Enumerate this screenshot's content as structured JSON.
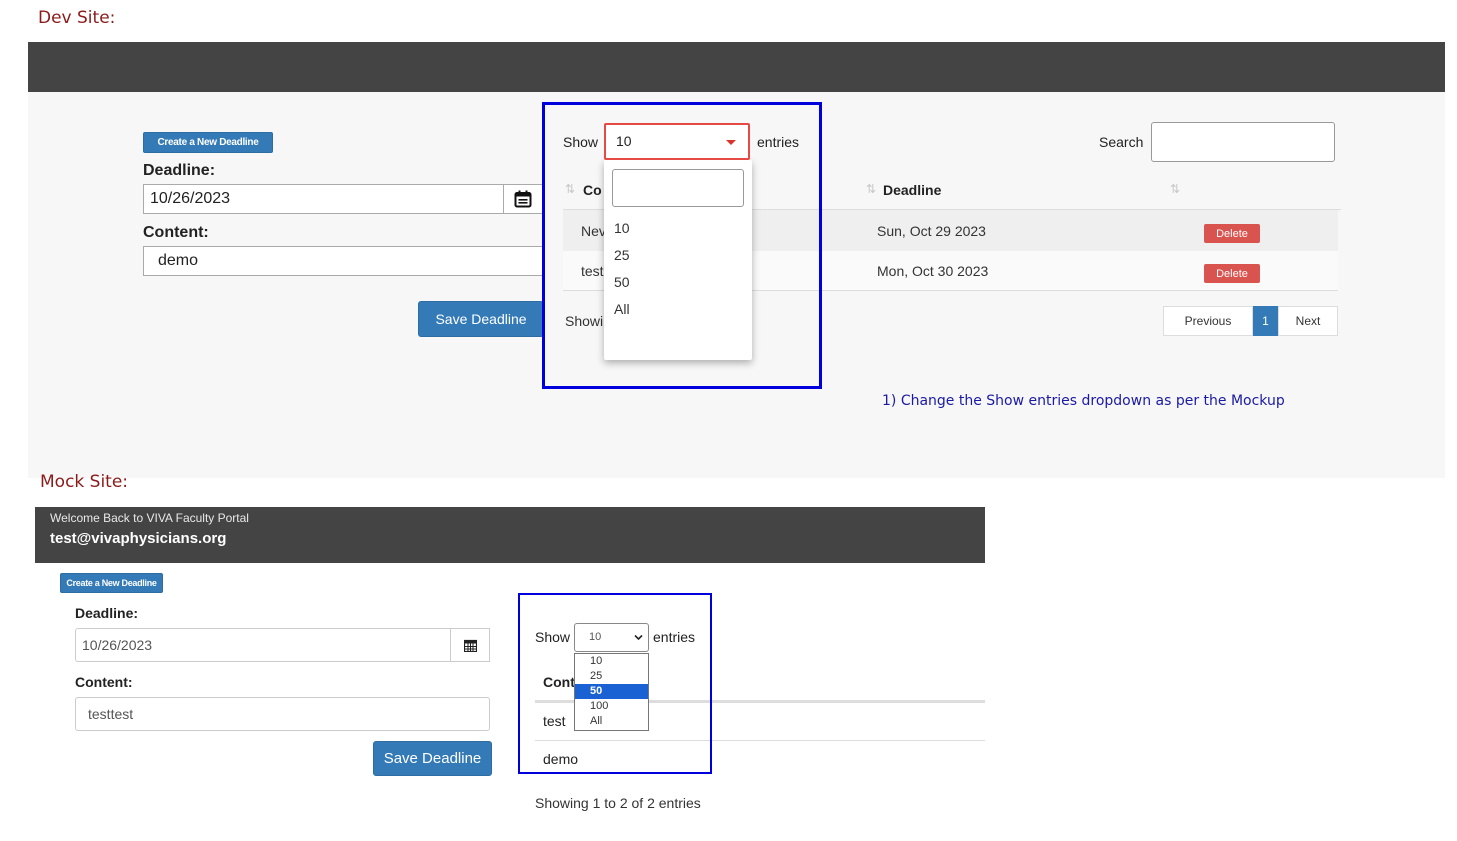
{
  "dev": {
    "section_title": "Dev Site:",
    "create_button": "Create a New Deadline",
    "deadline_label": "Deadline:",
    "deadline_value": "10/26/2023",
    "content_label": "Content:",
    "content_value": "demo",
    "save_button": "Save Deadline",
    "show_label": "Show",
    "show_selected": "10",
    "entries_label": "entries",
    "search_label": "Search",
    "search_value": "",
    "dropdown_options": [
      "10",
      "25",
      "50",
      "All"
    ],
    "columns": [
      "Co",
      "Deadline"
    ],
    "rows": [
      {
        "content": "Nev",
        "deadline": "Sun, Oct 29 2023",
        "action": "Delete"
      },
      {
        "content": "test",
        "deadline": "Mon, Oct 30 2023",
        "action": "Delete"
      }
    ],
    "showing_partial": "Showi",
    "pager": {
      "previous": "Previous",
      "page": "1",
      "next": "Next"
    },
    "note": "1) Change the Show entries dropdown as per the Mockup",
    "colors": {
      "note": "#1a1aa6",
      "box": "#0000dd",
      "danger": "#d9534f",
      "primary": "#337ab7"
    }
  },
  "mock": {
    "section_title": "Mock Site:",
    "welcome": "Welcome Back to VIVA Faculty Portal",
    "email": "test@vivaphysicians.org",
    "create_button": "Create a New Deadline",
    "deadline_label": "Deadline:",
    "deadline_value": "10/26/2023",
    "content_label": "Content:",
    "content_value": "testtest",
    "save_button": "Save Deadline",
    "show_label": "Show",
    "show_selected": "10",
    "entries_label": "entries",
    "options": [
      "10",
      "25",
      "50",
      "100",
      "All"
    ],
    "highlighted_option": "50",
    "column": "Cont",
    "rows": [
      "test",
      "demo"
    ],
    "showing": "Showing 1 to 2 of 2 entries"
  }
}
